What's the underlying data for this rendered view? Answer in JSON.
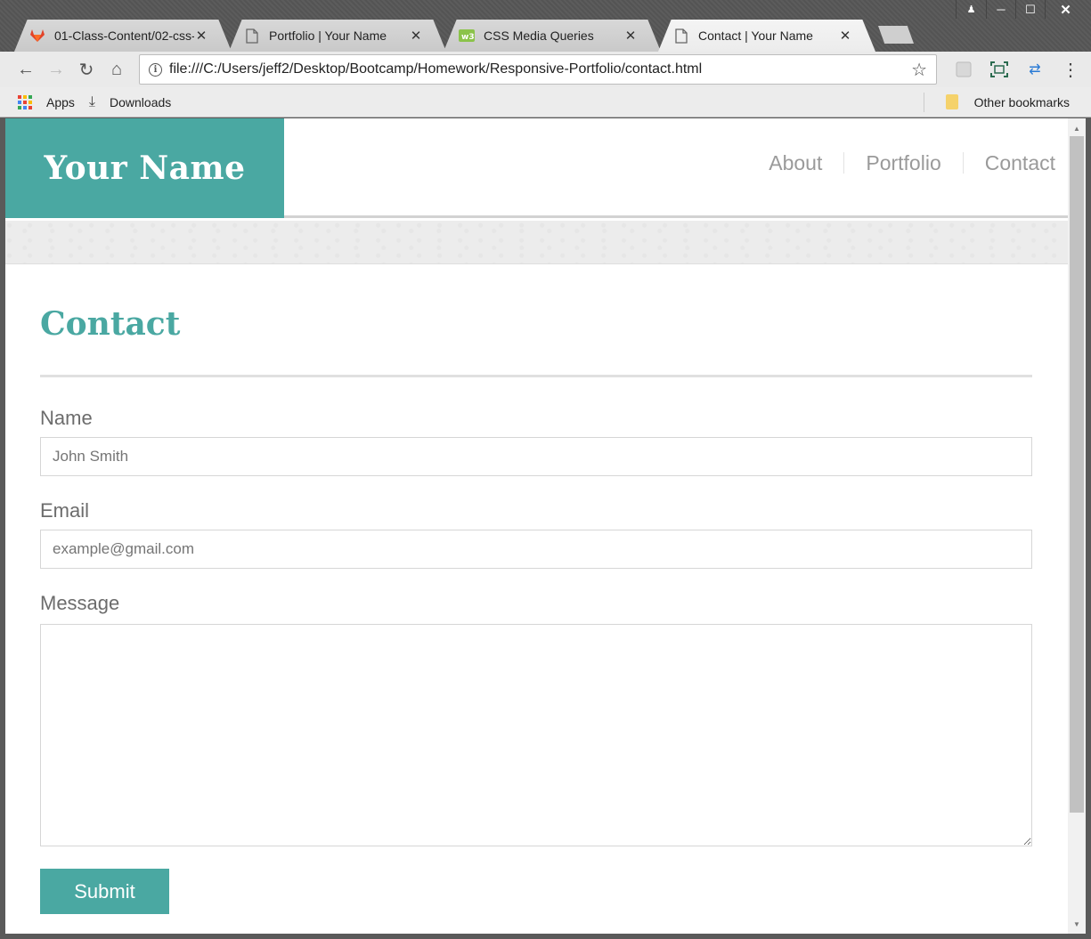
{
  "browser": {
    "tabs": [
      {
        "title": "01-Class-Content/02-css-",
        "favicon": "gitlab-fox-icon"
      },
      {
        "title": "Portfolio | Your Name",
        "favicon": "document-icon"
      },
      {
        "title": "CSS Media Queries",
        "favicon": "w3-icon"
      },
      {
        "title": "Contact | Your Name",
        "favicon": "document-icon"
      }
    ],
    "active_tab_index": 3,
    "url": "file:///C:/Users/jeff2/Desktop/Bootcamp/Homework/Responsive-Portfolio/contact.html",
    "bookmarks": {
      "apps_label": "Apps",
      "downloads_label": "Downloads",
      "other_label": "Other bookmarks"
    },
    "colors": {
      "apps_grid": [
        "#e94235",
        "#fbbc04",
        "#34a853",
        "#4285f4",
        "#e94235",
        "#fbbc04",
        "#34a853",
        "#4285f4",
        "#e94235"
      ]
    }
  },
  "site": {
    "brand": "Your Name",
    "nav": {
      "about": "About",
      "portfolio": "Portfolio",
      "contact": "Contact"
    },
    "accent_color": "#4aa8a2"
  },
  "contact": {
    "title": "Contact",
    "name_label": "Name",
    "name_placeholder": "John Smith",
    "email_label": "Email",
    "email_placeholder": "example@gmail.com",
    "message_label": "Message",
    "message_value": "",
    "submit_label": "Submit"
  }
}
